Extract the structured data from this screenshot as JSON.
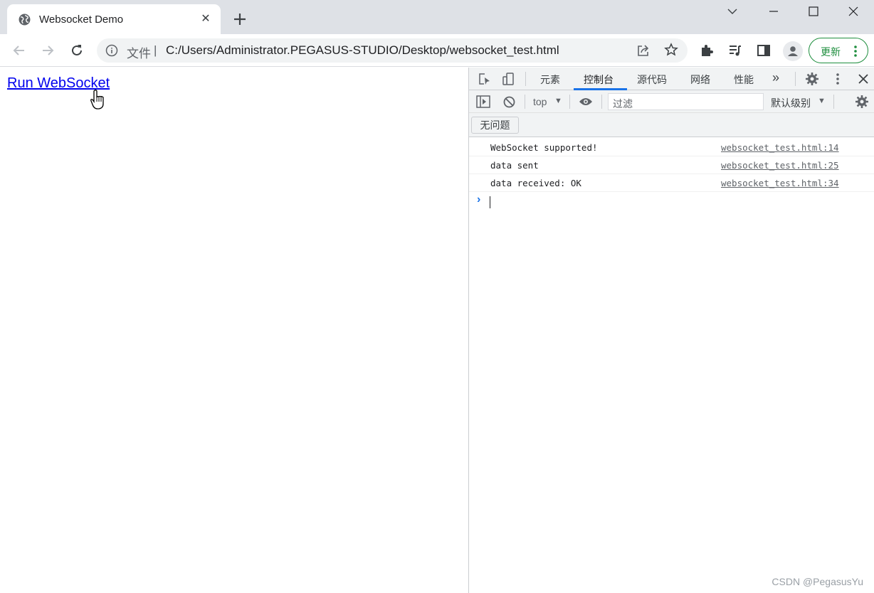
{
  "browser": {
    "tab": {
      "title": "Websocket Demo",
      "favicon": "globe-icon",
      "close_glyph": "✕"
    },
    "window_controls": [
      "chevron-down-icon",
      "minimize-icon",
      "maximize-icon",
      "close-icon"
    ],
    "omnibox": {
      "scheme_label": "文件",
      "separator": "|",
      "url": "C:/Users/Administrator.PEGASUS-STUDIO/Desktop/websocket_test.html"
    },
    "update_button": {
      "label": "更新"
    },
    "accent": "#1e8e3e"
  },
  "page": {
    "link_text": "Run WebSocket",
    "link_color": "#0000ee"
  },
  "devtools": {
    "tabs": [
      {
        "label": "元素",
        "active": false
      },
      {
        "label": "控制台",
        "active": true
      },
      {
        "label": "源代码",
        "active": false
      },
      {
        "label": "网络",
        "active": false
      },
      {
        "label": "性能",
        "active": false
      }
    ],
    "more_tabs_glyph": "»",
    "context": "top",
    "filter_placeholder": "过滤",
    "level": "默认级别",
    "dropdown_glyph": "▼",
    "issues": "无问题",
    "messages": [
      {
        "text": "WebSocket supported!",
        "source": "websocket_test.html:14"
      },
      {
        "text": "data sent",
        "source": "websocket_test.html:25"
      },
      {
        "text": "data received: OK",
        "source": "websocket_test.html:34"
      }
    ],
    "prompt_glyph": "›",
    "accent": "#1a73e8"
  },
  "watermark": "CSDN @PegasusYu"
}
